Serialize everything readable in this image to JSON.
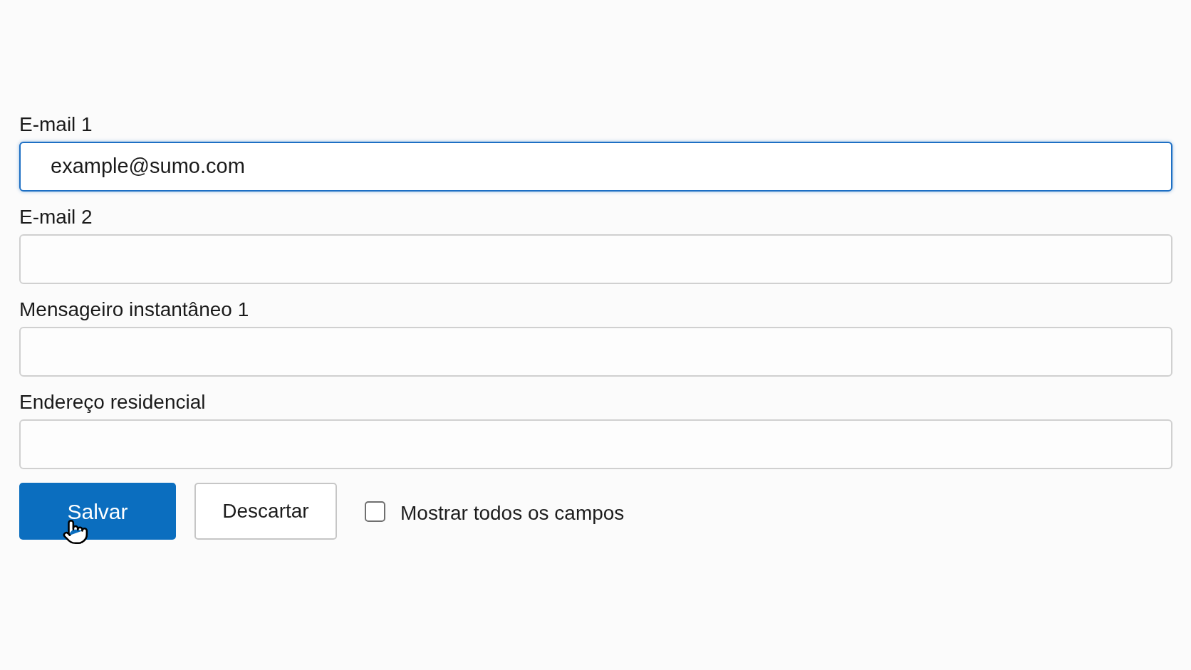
{
  "fields": [
    {
      "label": "E-mail 1",
      "value": "example@sumo.com",
      "focused": true
    },
    {
      "label": "E-mail 2",
      "focused": false
    },
    {
      "label": "Mensageiro instantâneo 1",
      "focused": false
    },
    {
      "label": "Endereço residencial",
      "focused": false
    }
  ],
  "buttons": [
    {
      "label": "Salvar",
      "kind": "primary"
    },
    {
      "label": "Descartar",
      "kind": "secondary"
    }
  ],
  "checkbox": {
    "label": "Mostrar todos os campos",
    "checked": false
  }
}
